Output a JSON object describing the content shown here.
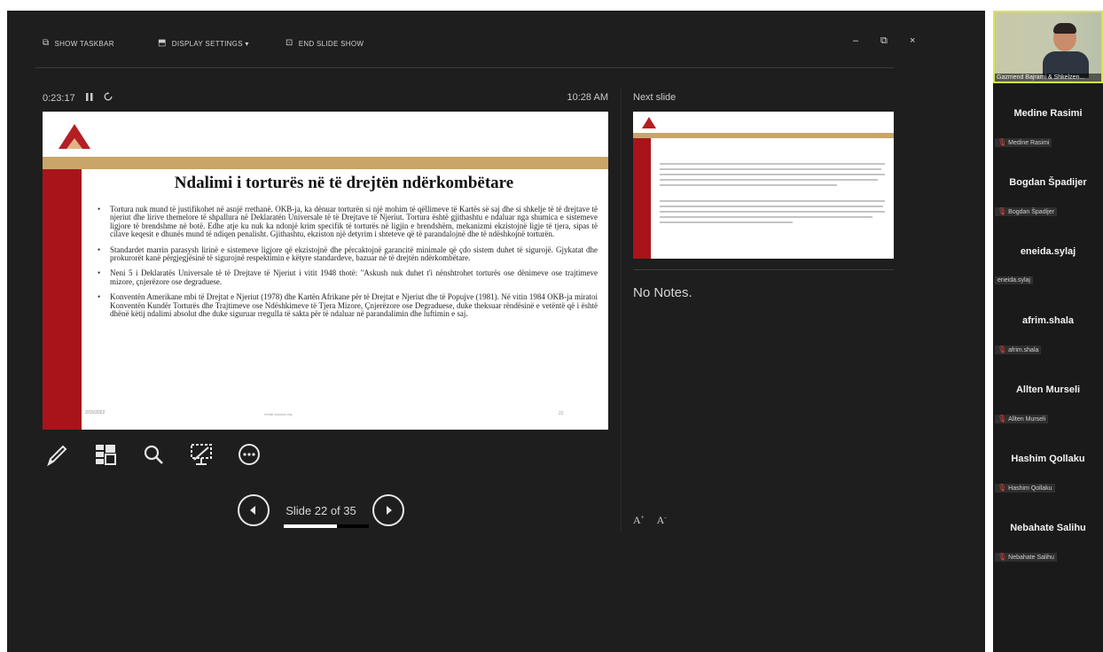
{
  "toolbar": {
    "show_taskbar": "SHOW TASKBAR",
    "display_settings": "DISPLAY SETTINGS ▾",
    "end_slide_show": "END SLIDE SHOW"
  },
  "window_controls": {
    "minimize": "–",
    "restore": "⧉",
    "close": "×"
  },
  "timer": {
    "elapsed": "0:23:17",
    "clock": "10:28 AM"
  },
  "slide": {
    "title": "Ndalimi i torturës në të drejtën ndërkombëtare",
    "bullets": [
      "Tortura nuk mund të justifikohet në asnjë rrethanë. OKB-ja, ka dënuar torturën si një mohim të qëllimeve të Kartës së saj dhe si shkelje të të drejtave të njeriut dhe lirive themelore të shpallura në Deklaratën Universale të të Drejtave të Njeriut. Tortura është gjithashtu e ndaluar nga shumica e sistemeve ligjore të brendshme në botë. Edhe atje ku nuk ka ndonjë krim specifik të torturës në ligjin e brendshëm, mekanizmi ekzistojnë ligje të tjera, sipas të cilave keqesit e dhunës mund të ndiqen penalisht. Gjithashtu, ekziston një detyrim i shteteve që të parandalojnë dhe të ndëshkojnë torturën.",
      "Standardet marrin parasysh lirinë e sistemeve ligjore që ekzistojnë dhe përcaktojnë garancitë minimale që çdo sistem duhet të sigurojë. Gjykatat dhe prokurorët kanë përgjegjësinë të sigurojnë respektimin e këtyre standardeve, bazuar në të drejtën ndërkombëtare.",
      "Neni 5 i Deklaratës Universale të të Drejtave të Njeriut i vitit 1948 thotë: \"Askush nuk duhet t'i nënshtrohet torturës ose dënimeve ose trajtimeve mizore, çnjerëzore ose degraduese.",
      "Konventën Amerikane mbi të Drejtat e Njeriut (1978) dhe Kartën Afrikane për të Drejtat e Njeriut dhe të Popujve (1981). Në vitin 1984 OKB-ja miratoi Konventën Kundër Torturës dhe Trajtimeve ose Ndëshkimeve të Tjera Mizore, Çnjerëzore ose Degraduese, duke theksuar rëndësinë e vetëntë që i është dhënë këtij ndalimi absolut dhe duke siguruar rregulla të sakta për të ndaluar në parandalimin dhe luftimin e saj."
    ],
    "date": "2/15/2022",
    "footer": "rehab-kosova.org",
    "number": "22"
  },
  "tools": {
    "pen": "pen-icon",
    "see_all_slides": "grid-icon",
    "zoom": "magnifier-icon",
    "black_screen": "screen-icon",
    "more": "more-icon"
  },
  "navigation": {
    "counter": "Slide 22 of 35",
    "current": 22,
    "total": 35
  },
  "next_panel": {
    "label": "Next slide",
    "notes": "No Notes.",
    "font_increase": "A",
    "font_decrease": "A"
  },
  "participants": {
    "self": "Gazmend Bajrami & Shkelzen...",
    "list": [
      {
        "big": "Medine Rasimi",
        "small": "Medine Rasimi",
        "muted": true
      },
      {
        "big": "Bogdan Špadijer",
        "small": "Bogdan Špadijer",
        "muted": true
      },
      {
        "big": "eneida.sylaj",
        "small": "eneida.sylaj",
        "muted": false
      },
      {
        "big": "afrim.shala",
        "small": "afrim.shala",
        "muted": true
      },
      {
        "big": "Allten Murseli",
        "small": "Allten Murseli",
        "muted": true
      },
      {
        "big": "Hashim Qollaku",
        "small": "Hashim Qollaku",
        "muted": true
      },
      {
        "big": "Nebahate Salihu",
        "small": "Nebahate Salihu",
        "muted": true
      }
    ]
  },
  "colors": {
    "accent_red": "#a8141a",
    "accent_gold": "#c9a56a",
    "active_speaker": "#d6e64c",
    "muted_mic": "#e0443a"
  }
}
